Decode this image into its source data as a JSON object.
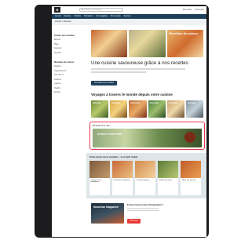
{
  "header": {
    "logo": "B",
    "search_placeholder": "Rechercher une recette",
    "links": [
      "Mes listes",
      "Connexion"
    ],
    "nav": [
      "Accueil",
      "Recettes",
      "Produits",
      "Promotions",
      "Nos magasins",
      "Mon compte",
      "Services"
    ]
  },
  "breadcrumb": "Accueil > Recettes",
  "sidebar": {
    "section1_title": "Toutes nos recettes",
    "section1_items": [
      "Entrées",
      "Plats",
      "Desserts",
      "Apéritifs"
    ],
    "section2_title": "Recettes de saison",
    "section2_items": [
      "Rapides",
      "Végétariennes",
      "Pas chères",
      "Festives",
      "Légères",
      "Healthy",
      "Enfants"
    ]
  },
  "hero": {
    "overlay": "Recettes de saison"
  },
  "main": {
    "title": "Une cuisine savoureuse grâce à nos recettes",
    "button": "Voir toutes les recettes"
  },
  "travel": {
    "title": "Voyagez à travers le monde depuis votre cuisine",
    "cats": [
      "Italienne",
      "Asiatique",
      "Mexicaine",
      "Orientale",
      "Française",
      "Grecque"
    ]
  },
  "highlight": {
    "title": "Recette à la une",
    "banner": "Cuisinez avec nous"
  },
  "week": {
    "title": "Votre menu de la semaine - à un tarif réduit",
    "cards": [
      "Lasagnes à la bolognaise",
      "Poulet rôti et légumes",
      "Curry de légumes",
      "Salade de saison",
      "Tajine aux abricots"
    ]
  },
  "promo": {
    "magazine": "Nouveau magazine",
    "title": "Envie d'encore plus d'inspiration ?",
    "button": "Découvrir"
  },
  "colors": {
    "nav": "#1d3f5a",
    "highlight": "#e6394b",
    "promo_button": "#e53935"
  }
}
